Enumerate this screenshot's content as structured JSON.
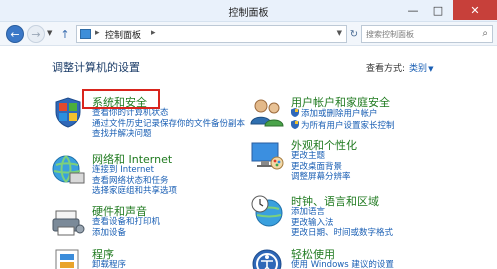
{
  "window": {
    "title": "控制面板",
    "close_label": "✕",
    "max_label": "□",
    "min_label": "—"
  },
  "toolbar": {
    "back_icon": "arrow-left-icon",
    "forward_icon": "arrow-right-icon",
    "breadcrumb_sep": "▸",
    "breadcrumb": "控制面板",
    "search_placeholder": "搜索控制面板"
  },
  "content": {
    "heading": "调整计算机的设置",
    "view_by_label": "查看方式:",
    "view_by_value": "类别"
  },
  "categories": {
    "system_security": {
      "title": "系统和安全",
      "links": [
        "查看你的计算机状态",
        "通过文件历史记录保存你的文件备份副本",
        "查找并解决问题"
      ]
    },
    "network": {
      "title": "网络和 Internet",
      "links": [
        "连接到 Internet",
        "查看网络状态和任务",
        "选择家庭组和共享选项"
      ]
    },
    "hardware": {
      "title": "硬件和声音",
      "links": [
        "查看设备和打印机",
        "添加设备"
      ]
    },
    "programs": {
      "title": "程序",
      "links": [
        "卸载程序"
      ]
    },
    "user_accounts": {
      "title": "用户帐户和家庭安全",
      "links": [
        "添加或删除用户帐户",
        "为所有用户设置家长控制"
      ]
    },
    "appearance": {
      "title": "外观和个性化",
      "links": [
        "更改主题",
        "更改桌面背景",
        "调整屏幕分辨率"
      ]
    },
    "clock_region": {
      "title": "时钟、语言和区域",
      "links": [
        "添加语言",
        "更改输入法",
        "更改日期、时间或数字格式"
      ]
    },
    "ease_access": {
      "title": "轻松使用",
      "links": [
        "使用 Windows 建议的设置"
      ]
    }
  }
}
